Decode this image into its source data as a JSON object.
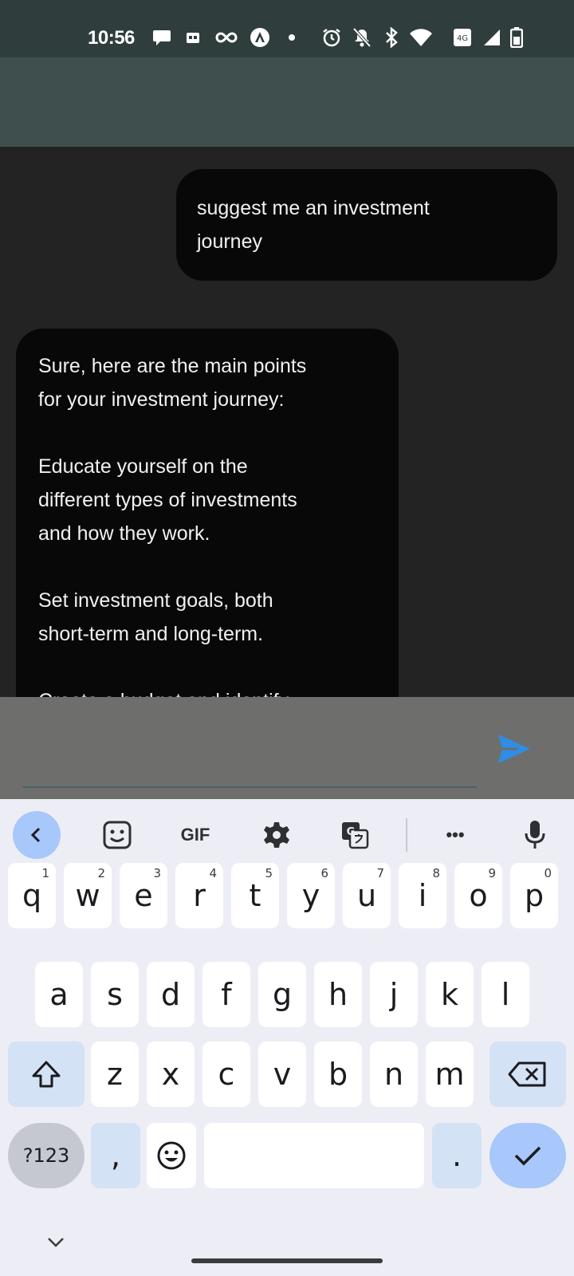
{
  "status_bar": {
    "time": "10:56",
    "left_icons": [
      "chat-bubble-icon",
      "image-icon",
      "infinity-icon",
      "accessibility-icon",
      "dot-icon"
    ],
    "right_icons": [
      "alarm-icon",
      "bell-off-icon",
      "bluetooth-icon",
      "wifi-icon",
      "data-icon",
      "signal-icon",
      "battery-icon"
    ]
  },
  "chat": {
    "messages": [
      {
        "role": "user",
        "text": "suggest me an investment\njourney"
      },
      {
        "role": "bot",
        "text": "Sure, here are the main points\nfor your investment journey:\n\nEducate yourself on the\ndifferent types of investments\nand how they work.\n\nSet investment goals, both\nshort-term and long-term.\n\nCreate a budget and identify"
      }
    ]
  },
  "input": {
    "value": "",
    "placeholder": ""
  },
  "keyboard": {
    "toolbar": {
      "gif_label": "GIF",
      "more_label": "•••"
    },
    "row1": [
      "q",
      "w",
      "e",
      "r",
      "t",
      "y",
      "u",
      "i",
      "o",
      "p"
    ],
    "row1_hints": [
      "1",
      "2",
      "3",
      "4",
      "5",
      "6",
      "7",
      "8",
      "9",
      "0"
    ],
    "row2": [
      "a",
      "s",
      "d",
      "f",
      "g",
      "h",
      "j",
      "k",
      "l"
    ],
    "row3": [
      "z",
      "x",
      "c",
      "v",
      "b",
      "n",
      "m"
    ],
    "symbols_label": "?123",
    "comma_label": ",",
    "period_label": "."
  },
  "colors": {
    "status_bar": "#2f3d3d",
    "app_bar": "#3e4f4d",
    "chat_bg": "#232324",
    "bubble": "#080808",
    "send_icon": "#2e8de6",
    "key_accent": "#a8c7fa"
  }
}
